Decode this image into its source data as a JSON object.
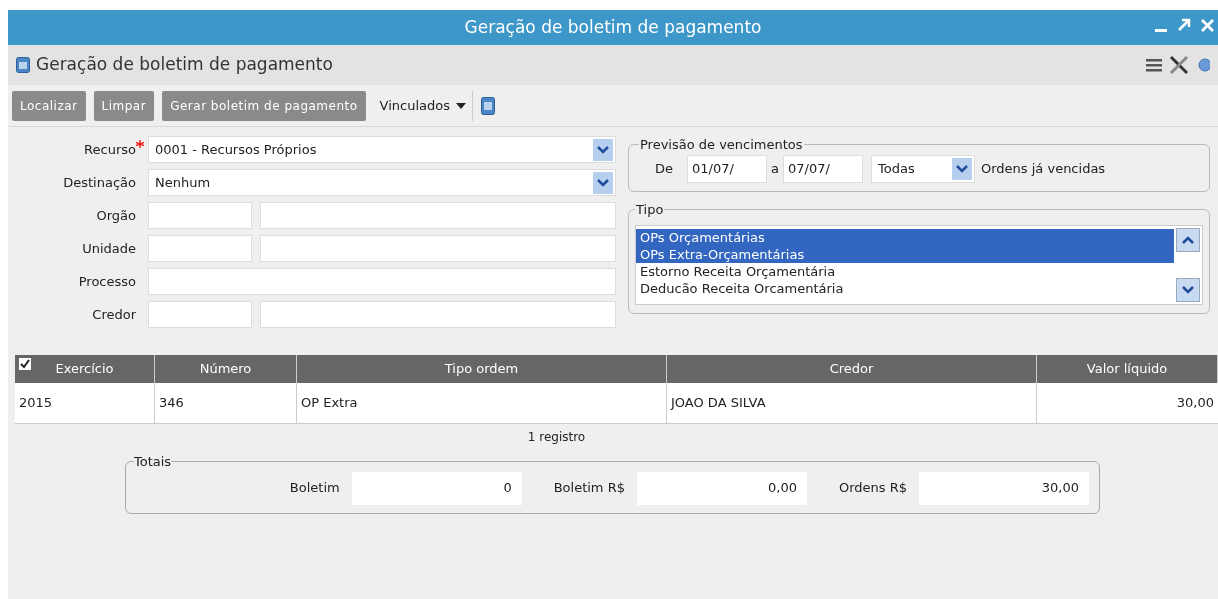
{
  "window": {
    "title": "Geração de boletim de pagamento"
  },
  "header": {
    "title": "Geração de boletim de pagamento"
  },
  "toolbar": {
    "buttons": [
      "Localizar",
      "Limpar",
      "Gerar boletim de pagamento"
    ],
    "dropdown": "Vinculados"
  },
  "form": {
    "fields": [
      {
        "label": "Recurso",
        "kind": "select",
        "required": true,
        "value": "0001 - Recursos Próprios"
      },
      {
        "label": "Destinação",
        "kind": "select",
        "required": false,
        "value": "Nenhum"
      },
      {
        "label": "Orgão",
        "kind": "pair",
        "required": false
      },
      {
        "label": "Unidade",
        "kind": "pair",
        "required": false
      },
      {
        "label": "Processo",
        "kind": "text",
        "required": false
      },
      {
        "label": "Credor",
        "kind": "pair",
        "required": false
      }
    ]
  },
  "previsao": {
    "legend": "Previsão de vencimentos",
    "from_label": "De",
    "from": "01/07/",
    "to_label": "a",
    "to": "07/07/",
    "filter": "Todas",
    "note": "Ordens já vencidas"
  },
  "tipo": {
    "legend": "Tipo",
    "options": [
      {
        "label": "OPs Orçamentárias",
        "selected": true
      },
      {
        "label": "OPs Extra-Orçamentárias",
        "selected": true
      },
      {
        "label": "Estorno Receita Orçamentária",
        "selected": false
      },
      {
        "label": "Deducão Receita Orcamentária",
        "selected": false
      }
    ]
  },
  "table": {
    "select_all_checked": true,
    "columns": [
      "Exercício",
      "Número",
      "Tipo ordem",
      "Credor",
      "Valor líquido"
    ],
    "rows": [
      [
        "2015",
        "346",
        "OP Extra",
        "JOAO DA SILVA",
        "30,00"
      ]
    ],
    "footer": "1 registro"
  },
  "totais": {
    "legend": "Totais",
    "fields": [
      {
        "label": "Boletim",
        "value": "0"
      },
      {
        "label": "Boletim R$",
        "value": "0,00"
      },
      {
        "label": "Ordens R$",
        "value": "30,00"
      }
    ]
  }
}
